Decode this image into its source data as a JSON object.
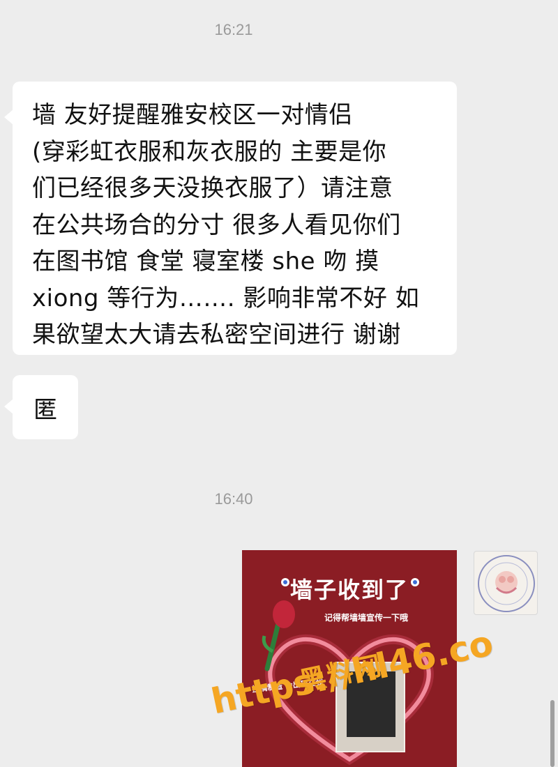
{
  "chat": {
    "timestamp_1": "16:21",
    "message_1_lines": [
      "墙 友好提醒雅安校区一对情侣",
      "(穿彩虹衣服和灰衣服的 主要是你",
      "们已经很多天没换衣服了）请注意",
      "在公共场合的分寸 很多人看见你们",
      "在图书馆 食堂 寝室楼 she 吻 摸",
      "xiong 等行为……. 影响非常不好 如",
      "果欲望太大请去私密空间进行 谢谢"
    ],
    "message_2": "匿",
    "timestamp_2": "16:40",
    "image_message": {
      "title": "墙子收到了",
      "subtitle": "记得帮墙墙宣传一下哦",
      "sticker": "投稿制造 会出现在我"
    }
  },
  "watermark": {
    "brand": "黑料网",
    "url": "https://hl46.co"
  },
  "colors": {
    "background": "#ededed",
    "bubble": "#ffffff",
    "image_bg": "#8b1d24",
    "watermark": "#f5a623",
    "timestamp": "#9a9a9a"
  }
}
